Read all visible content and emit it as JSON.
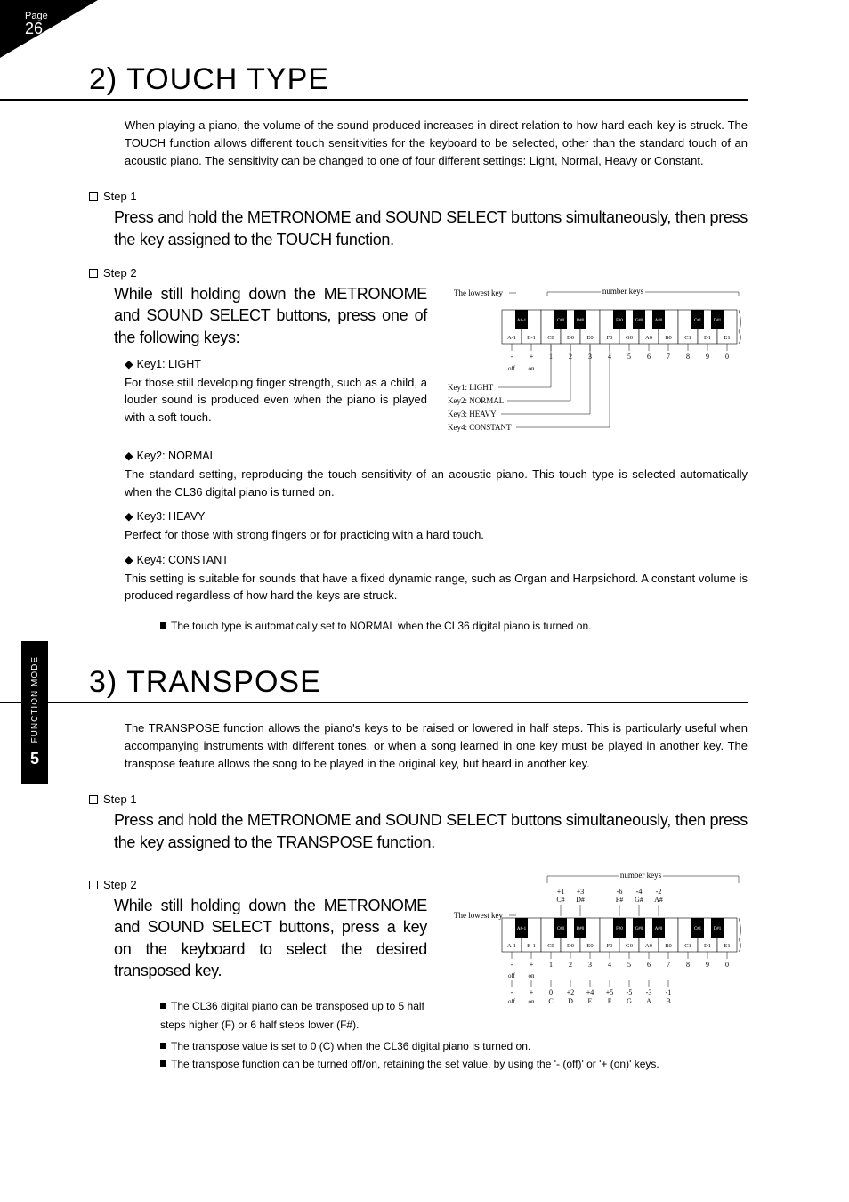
{
  "page": {
    "label": "Page",
    "number": "26"
  },
  "sidebar": {
    "chapter": "5",
    "title": "FUNCTION MODE"
  },
  "touch": {
    "heading": "2) TOUCH TYPE",
    "intro": "When playing a piano, the volume of the sound produced increases in direct relation to how hard each key is struck.  The TOUCH function allows different touch sensitivities for the keyboard to be selected, other than the standard touch of an acoustic piano. The sensitivity can be changed to one of four different settings: Light, Normal, Heavy or Constant.",
    "step1_label": "Step 1",
    "step1_text": "Press and hold the METRONOME and SOUND SELECT buttons simultaneously, then press the key assigned to the TOUCH function.",
    "step2_label": "Step 2",
    "step2_text": "While still holding down the METRONOME and SOUND SELECT buttons, press one of the following keys:",
    "k1t": "Key1: LIGHT",
    "k1d": "For those still developing finger strength, such as a child, a louder sound is produced even when the piano is played with a soft touch.",
    "k2t": "Key2: NORMAL",
    "k2d": "The standard setting, reproducing the touch sensitivity of an acoustic piano. This touch type is selected automatically when the CL36 digital piano is turned on.",
    "k3t": "Key3: HEAVY",
    "k3d": "Perfect for those with strong fingers or for practicing with a hard touch.",
    "k4t": "Key4: CONSTANT",
    "k4d": "This setting is suitable for sounds that have a fixed dynamic range, such as Organ and Harpsichord.  A constant volume is produced regardless of how hard the keys are struck.",
    "note1": "The touch type is automatically set to NORMAL when the CL36 digital piano is turned on.",
    "diag": {
      "lowest": "The lowest key",
      "numkeys": "number keys",
      "off": "off",
      "on": "on",
      "row_top": [
        "-",
        "+",
        "1",
        "2",
        "3",
        "4",
        "5",
        "6",
        "7",
        "8",
        "9",
        "0"
      ],
      "white": [
        "A-1",
        "B-1",
        "C0",
        "D0",
        "E0",
        "F0",
        "G0",
        "A0",
        "B0",
        "C1",
        "D1",
        "E1"
      ],
      "black": [
        "A#-1",
        "C#0",
        "D#0",
        "F#0",
        "G#0",
        "A#0",
        "C#1",
        "D#1"
      ],
      "l1": "Key1: LIGHT",
      "l2": "Key2: NORMAL",
      "l3": "Key3: HEAVY",
      "l4": "Key4: CONSTANT"
    }
  },
  "transpose": {
    "heading": "3) TRANSPOSE",
    "intro": "The TRANSPOSE function allows the piano's keys to be raised or lowered in half steps. This is particularly useful when accompanying instruments with different tones, or when a song learned in one key must be played in another key. The transpose feature allows the song to be played in the original key, but heard in another key.",
    "step1_label": "Step 1",
    "step1_text": "Press and hold the METRONOME and SOUND SELECT buttons simultaneously, then press the key assigned to the TRANSPOSE function.",
    "step2_label": "Step 2",
    "step2_text": "While still holding down the METRONOME and SOUND SELECT buttons, press a key on the keyboard to select the desired transposed key.",
    "note1": "The CL36 digital piano can be transposed up to 5 half steps higher (F) or 6 half steps lower (F#).",
    "note2": "The transpose value is set to 0 (C) when the CL36 digital piano is turned on.",
    "note3": "The transpose function can be turned off/on, retaining the set value, by using the '- (off)' or '+ (on)' keys.",
    "diag": {
      "lowest": "The lowest key",
      "numkeys": "number keys",
      "off": "off",
      "on": "on",
      "row_top": [
        "-",
        "+",
        "1",
        "2",
        "3",
        "4",
        "5",
        "6",
        "7",
        "8",
        "9",
        "0"
      ],
      "row_bot_sym": [
        "-",
        "+"
      ],
      "row_bot_off": "off",
      "row_bot_on": "on",
      "row_bot": [
        "0",
        "+2",
        "+4",
        "+5",
        "-5",
        "-3",
        "-1"
      ],
      "row_bot2": [
        "C",
        "D",
        "E",
        "F",
        "G",
        "A",
        "B"
      ],
      "black_top": [
        "+1",
        "+3",
        "-6",
        "-4",
        "-2"
      ],
      "black_top2": [
        "C#",
        "D#",
        "F#",
        "G#",
        "A#"
      ],
      "white": [
        "A-1",
        "B-1",
        "C0",
        "D0",
        "E0",
        "F0",
        "G0",
        "A0",
        "B0",
        "C1",
        "D1",
        "E1"
      ],
      "black": [
        "A#-1",
        "C#0",
        "D#0",
        "F#0",
        "G#0",
        "A#0",
        "C#1",
        "D#1"
      ]
    }
  }
}
